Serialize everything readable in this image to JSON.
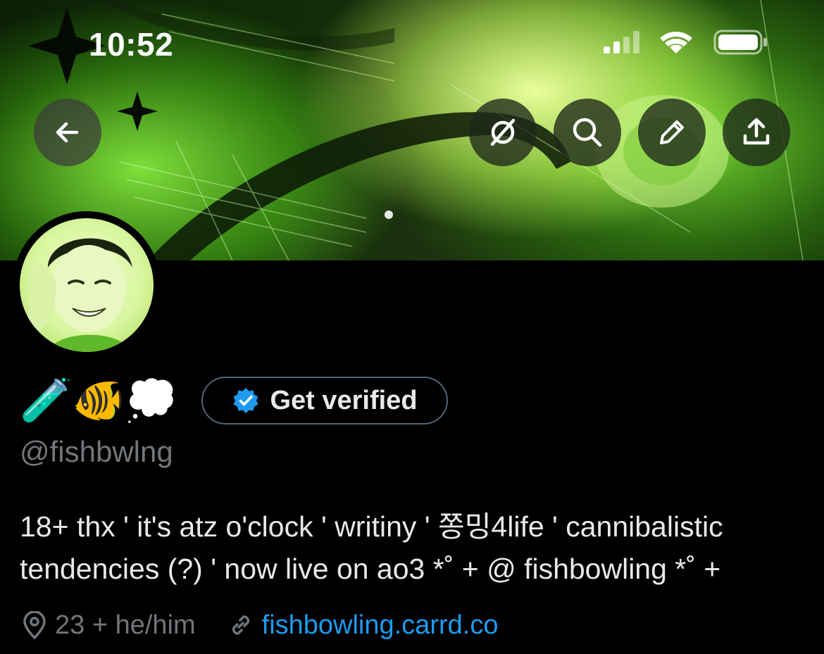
{
  "status_bar": {
    "time": "10:52"
  },
  "header": {
    "icons": [
      "back-arrow-icon",
      "grok-icon",
      "search-icon",
      "edit-icon",
      "share-icon"
    ]
  },
  "profile": {
    "display_name_emojis": "🧪🐠💭",
    "verify_button_label": "Get verified",
    "handle": "@fishbwlng",
    "bio_line_1": "18+ thx ' it's atz o'clock ' writiny ' 쫑밍4life ' cannibalistic",
    "bio_line_2": "tendencies (?) ' now live on ao3 *˚ + @ fishbowling *˚ +",
    "location": "23 + he/him",
    "website": "fishbowling.carrd.co"
  },
  "colors": {
    "background": "#000000",
    "text": "#e7e9ea",
    "muted": "#71767b",
    "link": "#1d9bf0",
    "verified_badge": "#1d9bf0",
    "banner_accent": "#bff06a"
  }
}
